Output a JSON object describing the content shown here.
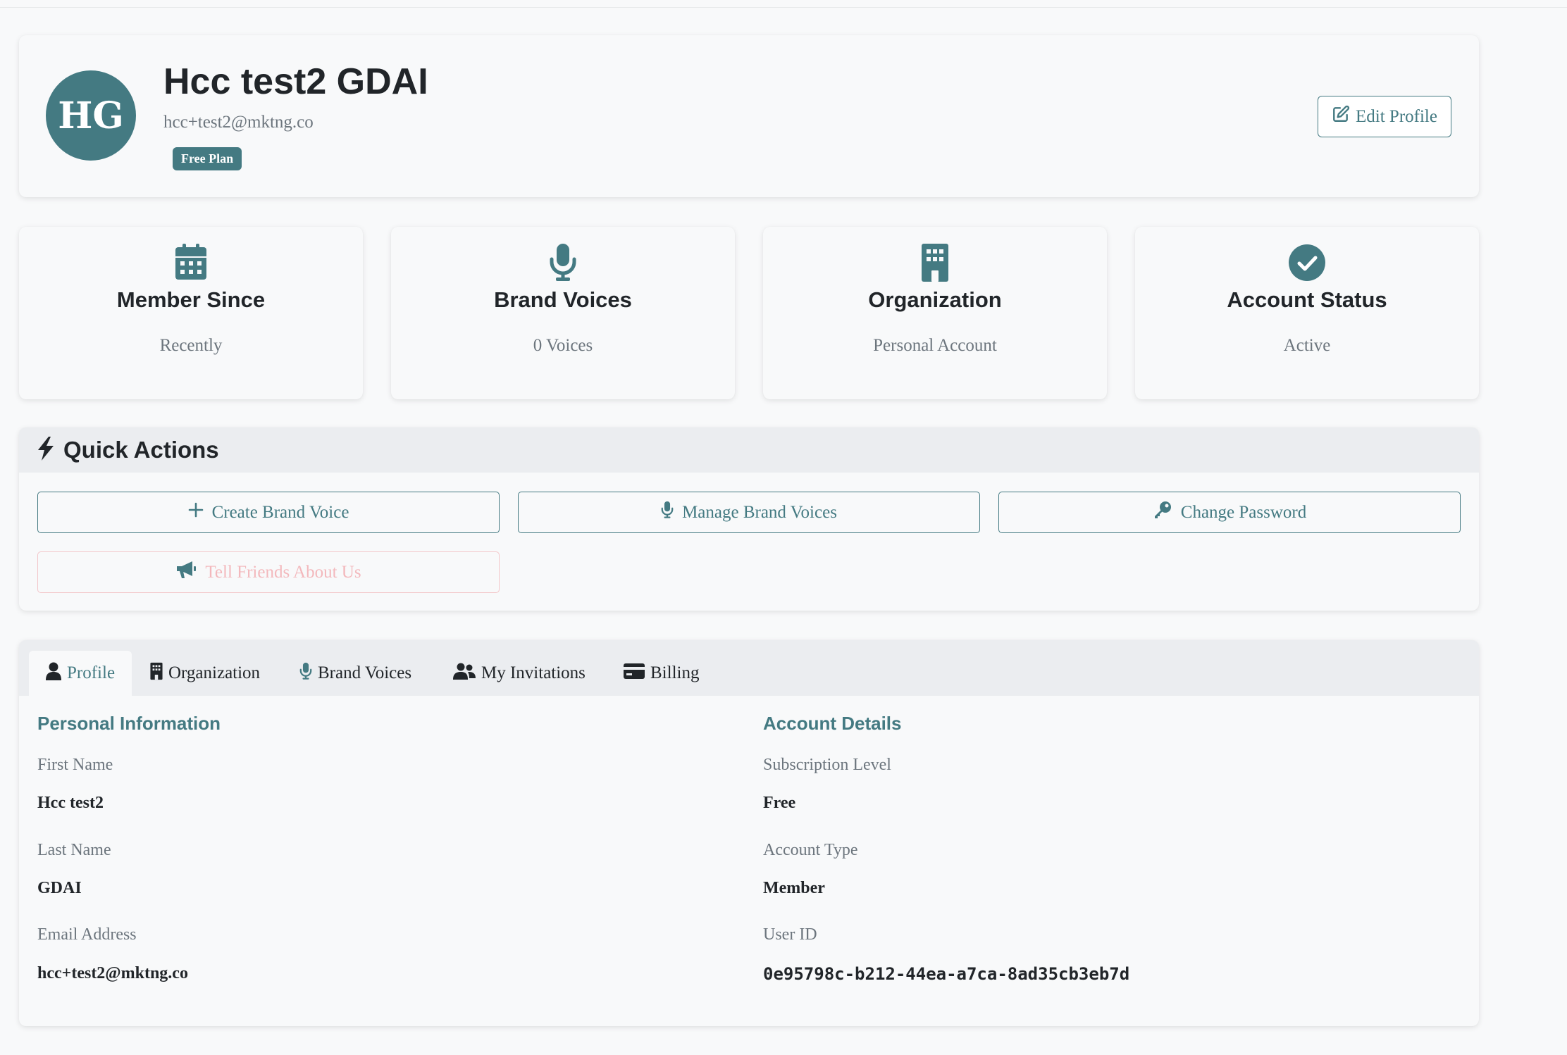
{
  "profile": {
    "initials": "HG",
    "name": "Hcc test2 GDAI",
    "email": "hcc+test2@mktng.co",
    "plan_badge": "Free Plan",
    "edit_label": "Edit Profile"
  },
  "stats": [
    {
      "title": "Member Since",
      "value": "Recently",
      "icon": "calendar-icon"
    },
    {
      "title": "Brand Voices",
      "value": "0 Voices",
      "icon": "microphone-icon"
    },
    {
      "title": "Organization",
      "value": "Personal Account",
      "icon": "building-icon"
    },
    {
      "title": "Account Status",
      "value": "Active",
      "icon": "check-circle-icon"
    }
  ],
  "quick_actions": {
    "title": "Quick Actions",
    "buttons": [
      {
        "label": "Create Brand Voice",
        "icon": "plus-icon"
      },
      {
        "label": "Manage Brand Voices",
        "icon": "microphone-icon"
      },
      {
        "label": "Change Password",
        "icon": "key-icon"
      },
      {
        "label": "Tell Friends About Us",
        "icon": "megaphone-icon"
      }
    ]
  },
  "tabs": [
    {
      "label": "Profile",
      "icon": "user-icon",
      "active": true
    },
    {
      "label": "Organization",
      "icon": "building-icon"
    },
    {
      "label": "Brand Voices",
      "icon": "microphone-icon"
    },
    {
      "label": "My Invitations",
      "icon": "users-icon"
    },
    {
      "label": "Billing",
      "icon": "credit-card-icon"
    }
  ],
  "personal_info": {
    "title": "Personal Information",
    "first_name_label": "First Name",
    "first_name": "Hcc test2",
    "last_name_label": "Last Name",
    "last_name": "GDAI",
    "email_label": "Email Address",
    "email": "hcc+test2@mktng.co"
  },
  "account_details": {
    "title": "Account Details",
    "subscription_label": "Subscription Level",
    "subscription": "Free",
    "account_type_label": "Account Type",
    "account_type": "Member",
    "user_id_label": "User ID",
    "user_id": "0e95798c-b212-44ea-a7ca-8ad35cb3eb7d"
  },
  "colors": {
    "accent": "#447a82",
    "faded_button": "#f3b8bc",
    "muted_text": "#6c757d"
  }
}
